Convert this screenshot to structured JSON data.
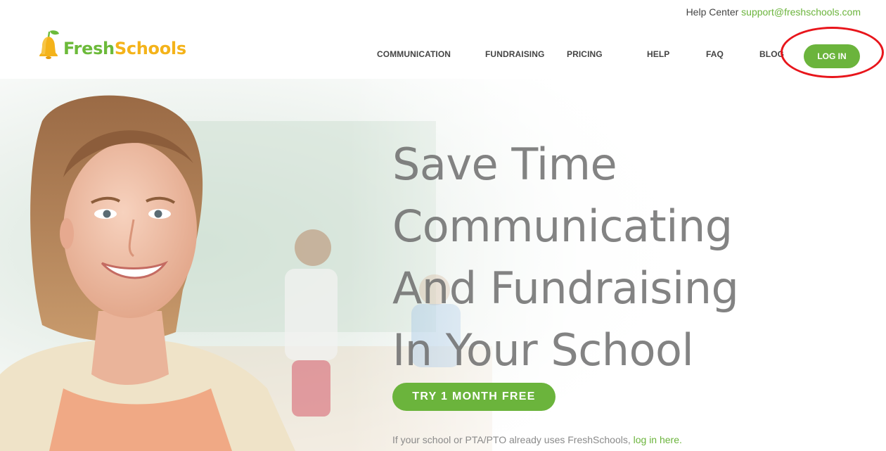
{
  "header": {
    "help_center_label": "Help Center",
    "support_email": "support@freshschools.com",
    "logo": {
      "part1": "Fresh",
      "part2": "Schools",
      "colors": {
        "fresh": "#6cba3a",
        "schools": "#f4b31a"
      },
      "icon": "bell-pear-icon"
    }
  },
  "nav": {
    "items": [
      {
        "label": "COMMUNICATION"
      },
      {
        "label": "FUNDRAISING"
      },
      {
        "label": "PRICING"
      },
      {
        "label": "HELP"
      },
      {
        "label": "FAQ"
      },
      {
        "label": "BLOG"
      }
    ],
    "login_label": "LOG IN"
  },
  "hero": {
    "headline_lines": [
      "Save Time",
      "Communicating",
      "And Fundraising",
      "In Your School"
    ],
    "cta_label": "TRY 1 MONTH FREE",
    "note_prefix": "If your school or PTA/PTO already uses FreshSchools,",
    "note_link": "log in here."
  },
  "colors": {
    "accent_green": "#6bb43c",
    "highlight_red": "#e8151b",
    "headline_gray": "#6e6e6e"
  }
}
